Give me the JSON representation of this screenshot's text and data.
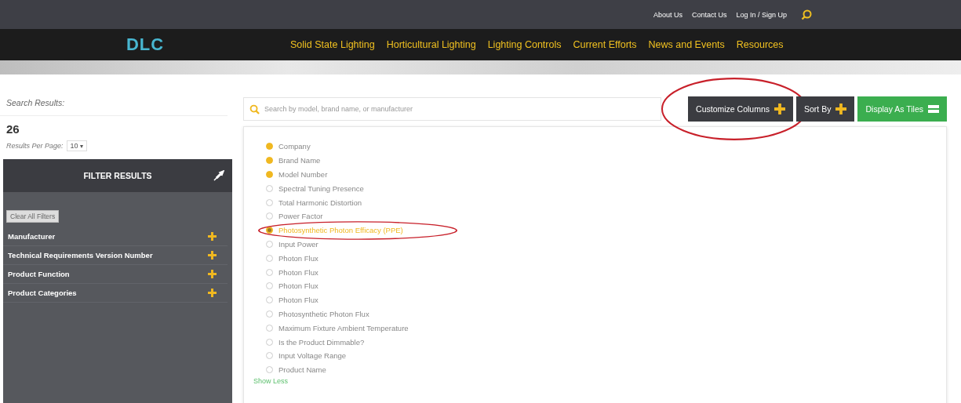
{
  "top_links": [
    {
      "label": "About Us"
    },
    {
      "label": "Contact Us"
    },
    {
      "label": "Log In / Sign Up"
    }
  ],
  "logo": {
    "text": "DLC"
  },
  "nav": [
    {
      "label": "Solid State Lighting"
    },
    {
      "label": "Horticultural Lighting"
    },
    {
      "label": "Lighting Controls"
    },
    {
      "label": "Current Efforts"
    },
    {
      "label": "News and Events"
    },
    {
      "label": "Resources"
    }
  ],
  "sidebar": {
    "results_label": "Search Results:",
    "count": "26",
    "per_page_label": "Results Per Page:",
    "per_page_value": "10",
    "per_page_arrow": "▾",
    "filter_title": "FILTER RESULTS",
    "clear_button": "Clear All Filters",
    "filters": [
      {
        "label": "Manufacturer"
      },
      {
        "label": "Technical Requirements Version Number"
      },
      {
        "label": "Product Function"
      },
      {
        "label": "Product Categories"
      }
    ]
  },
  "search": {
    "placeholder": "Search by model, brand name, or manufacturer"
  },
  "buttons": [
    {
      "label": "Customize Columns",
      "kind": "plus",
      "circled": true
    },
    {
      "label": "Sort By",
      "kind": "plus",
      "circled": false
    },
    {
      "label": "Display As Tiles",
      "kind": "tiles",
      "circled": false
    }
  ],
  "columns": [
    {
      "label": "Company",
      "checked": true,
      "highlighted": false
    },
    {
      "label": "Brand Name",
      "checked": true,
      "highlighted": false
    },
    {
      "label": "Model Number",
      "checked": true,
      "highlighted": false
    },
    {
      "label": "Spectral Tuning Presence",
      "checked": false,
      "highlighted": false
    },
    {
      "label": "Total Harmonic Distortion",
      "checked": false,
      "highlighted": false
    },
    {
      "label": "Power Factor",
      "checked": false,
      "highlighted": false
    },
    {
      "label": "Photosynthetic Photon Efficacy (PPE)",
      "checked": true,
      "highlighted": true
    },
    {
      "label": "Input Power",
      "checked": false,
      "highlighted": false
    },
    {
      "label": "Photon Flux",
      "checked": false,
      "highlighted": false
    },
    {
      "label": "Photon Flux",
      "checked": false,
      "highlighted": false
    },
    {
      "label": "Photon Flux",
      "checked": false,
      "highlighted": false
    },
    {
      "label": "Photon Flux",
      "checked": false,
      "highlighted": false
    },
    {
      "label": "Photosynthetic Photon Flux",
      "checked": false,
      "highlighted": false
    },
    {
      "label": "Maximum Fixture Ambient Temperature",
      "checked": false,
      "highlighted": false
    },
    {
      "label": "Is the Product Dimmable?",
      "checked": false,
      "highlighted": false
    },
    {
      "label": "Input Voltage Range",
      "checked": false,
      "highlighted": false
    },
    {
      "label": "Product Name",
      "checked": false,
      "highlighted": false
    }
  ],
  "show_less": "Show Less"
}
